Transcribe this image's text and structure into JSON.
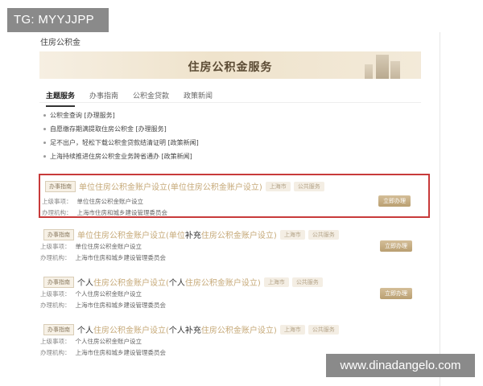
{
  "watermarks": {
    "top_left": "TG: MYYJJPP",
    "bottom_right": "www.dinadangelo.com"
  },
  "breadcrumb": "住房公积金",
  "banner": {
    "title": "住房公积金服务"
  },
  "tabs": [
    {
      "label": "主题服务",
      "active": true
    },
    {
      "label": "办事指南",
      "active": false
    },
    {
      "label": "公积金贷款",
      "active": false
    },
    {
      "label": "政策新闻",
      "active": false
    }
  ],
  "news": [
    "公积金查询 [办理服务]",
    "自愿缴存期满提取住房公积金 [办理服务]",
    "足不出户，轻松下载公积金贷款结清证明 [政策新闻]",
    "上海持续推进住房公积金业务跨省通办 [政策新闻]"
  ],
  "cards": {
    "badge": "办事指南",
    "superior_label": "上级事项：",
    "org_label": "办理机构：",
    "button_label": "立即办理",
    "items": [
      {
        "title": {
          "prefix": "",
          "p1": "单位住房公积金账户设立(单位住房公积金账户设立)"
        },
        "tags": [
          "上海市",
          "公共服务"
        ],
        "superior": "单位住房公积金账户设立",
        "org": "上海市住房和城乡建设管理委员会"
      },
      {
        "title": {
          "prefix": "",
          "p1": "单位住房公积金账户设立(单位",
          "bold": "补充",
          "p2": "住房公积金账户设立)"
        },
        "tags": [
          "上海市",
          "公共服务"
        ],
        "superior": "单位住房公积金账户设立",
        "org": "上海市住房和城乡建设管理委员会"
      },
      {
        "title": {
          "prefix": "个人",
          "p1": "住房公积金账户设立(",
          "bold": "个人",
          "p2": "住房公积金账户设立)"
        },
        "tags": [
          "上海市",
          "公共服务"
        ],
        "superior": "个人住房公积金账户设立",
        "org": "上海市住房和城乡建设管理委员会"
      },
      {
        "title": {
          "prefix": "个人",
          "p1": "住房公积金账户设立(",
          "bold": "个人补充",
          "p2": "住房公积金账户设立)"
        },
        "tags": [
          "上海市",
          "公共服务"
        ],
        "superior": "个人住房公积金账户设立",
        "org": "上海市住房和城乡建设管理委员会"
      }
    ]
  },
  "colors": {
    "highlight_border": "#c83a3a",
    "gold": "#c6a978",
    "button": "#c4aa7e"
  }
}
